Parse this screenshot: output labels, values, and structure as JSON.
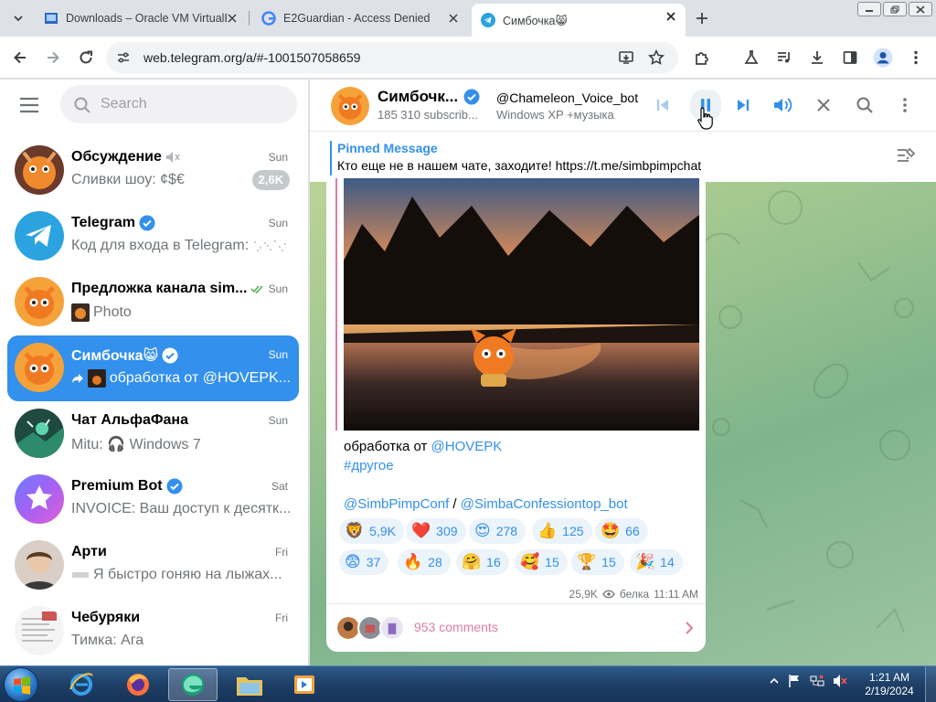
{
  "browser": {
    "tabs": [
      {
        "title": "Downloads – Oracle VM VirtualBox",
        "state": "inactive"
      },
      {
        "title": "E2Guardian - Access Denied",
        "state": "inactive"
      },
      {
        "title": "Симбочка😸",
        "state": "active"
      }
    ],
    "url": "web.telegram.org/a/#-1001507058659"
  },
  "telegram": {
    "search_placeholder": "Search",
    "chats": [
      {
        "name": "Обсуждение",
        "time": "Sun",
        "preview": "Сливки шоу: ¢$€",
        "badge": "2,6K",
        "muted": true
      },
      {
        "name": "Telegram",
        "time": "Sun",
        "preview": "Код для входа в Telegram:",
        "verified": true
      },
      {
        "name": "Предложка канала sim...",
        "time": "Sun",
        "preview": "Photo",
        "read": true
      },
      {
        "name": "Симбочка😸",
        "time": "Sun",
        "preview": "обработка от @HOVEPK...",
        "verified": true,
        "selected": true
      },
      {
        "name": "Чат АльфаФана",
        "time": "Sun",
        "preview": "Mitu: 🎧 Windows 7"
      },
      {
        "name": "Premium Bot",
        "time": "Sat",
        "preview": "INVOICE: Ваш доступ к десятк...",
        "verified": true
      },
      {
        "name": "Арти",
        "time": "Fri",
        "preview": "Я быстро гоняю на лыжах..."
      },
      {
        "name": "Чебуряки",
        "time": "Fri",
        "preview": "Тимка: Ага"
      }
    ],
    "header": {
      "title": "Симбочк...",
      "subscribers": "185 310 subscrib...",
      "player_title": "@Chameleon_Voice_bot",
      "player_subtitle": "Windows XP +музыка"
    },
    "pinned": {
      "label": "Pinned Message",
      "text": "Кто еще не в нашем чате, заходите! https://t.me/simbpimpchat"
    },
    "post": {
      "caption_prefix": "обработка от ",
      "caption_mention": "@HOVEPK",
      "hashtag": "#другое",
      "link1": "@SimbPimpConf",
      "link_sep": " / ",
      "link2": "@SimbaConfessiontop_bot",
      "reactions": [
        {
          "emoji": "🦁",
          "count": "5,9K"
        },
        {
          "emoji": "❤️",
          "count": "309"
        },
        {
          "emoji": "😍",
          "count": "278"
        },
        {
          "emoji": "👍",
          "count": "125"
        },
        {
          "emoji": "🤩",
          "count": "66"
        },
        {
          "emoji": "😨",
          "count": "37"
        },
        {
          "emoji": "🔥",
          "count": "28"
        },
        {
          "emoji": "🤗",
          "count": "16"
        },
        {
          "emoji": "🥰",
          "count": "15"
        },
        {
          "emoji": "🏆",
          "count": "15"
        },
        {
          "emoji": "🎉",
          "count": "14"
        }
      ],
      "views": "25,9K",
      "author": "белка",
      "time": "11:11 AM",
      "comments": "953 comments"
    }
  },
  "taskbar": {
    "time": "1:21 AM",
    "date": "2/19/2024"
  },
  "colors": {
    "accent": "#3390ec",
    "selected_chat": "#3390ec",
    "comment_link": "#e07ca0",
    "reaction_bg": "#ebf3fb"
  }
}
